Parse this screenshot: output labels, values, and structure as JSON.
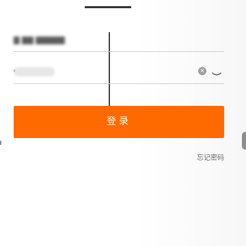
{
  "tabs": {
    "left_label": "",
    "active_label": ""
  },
  "account": {
    "value": "▇ ▇▇ ▇▇▇▇▇"
  },
  "password": {
    "clear_icon": "clear-icon",
    "toggle_icon": "eye-icon"
  },
  "login_button": {
    "label": "登录"
  },
  "forgot_link": {
    "label": "忘记密码"
  },
  "colors": {
    "accent": "#ff6a00",
    "divider": "#cfcfcf"
  }
}
